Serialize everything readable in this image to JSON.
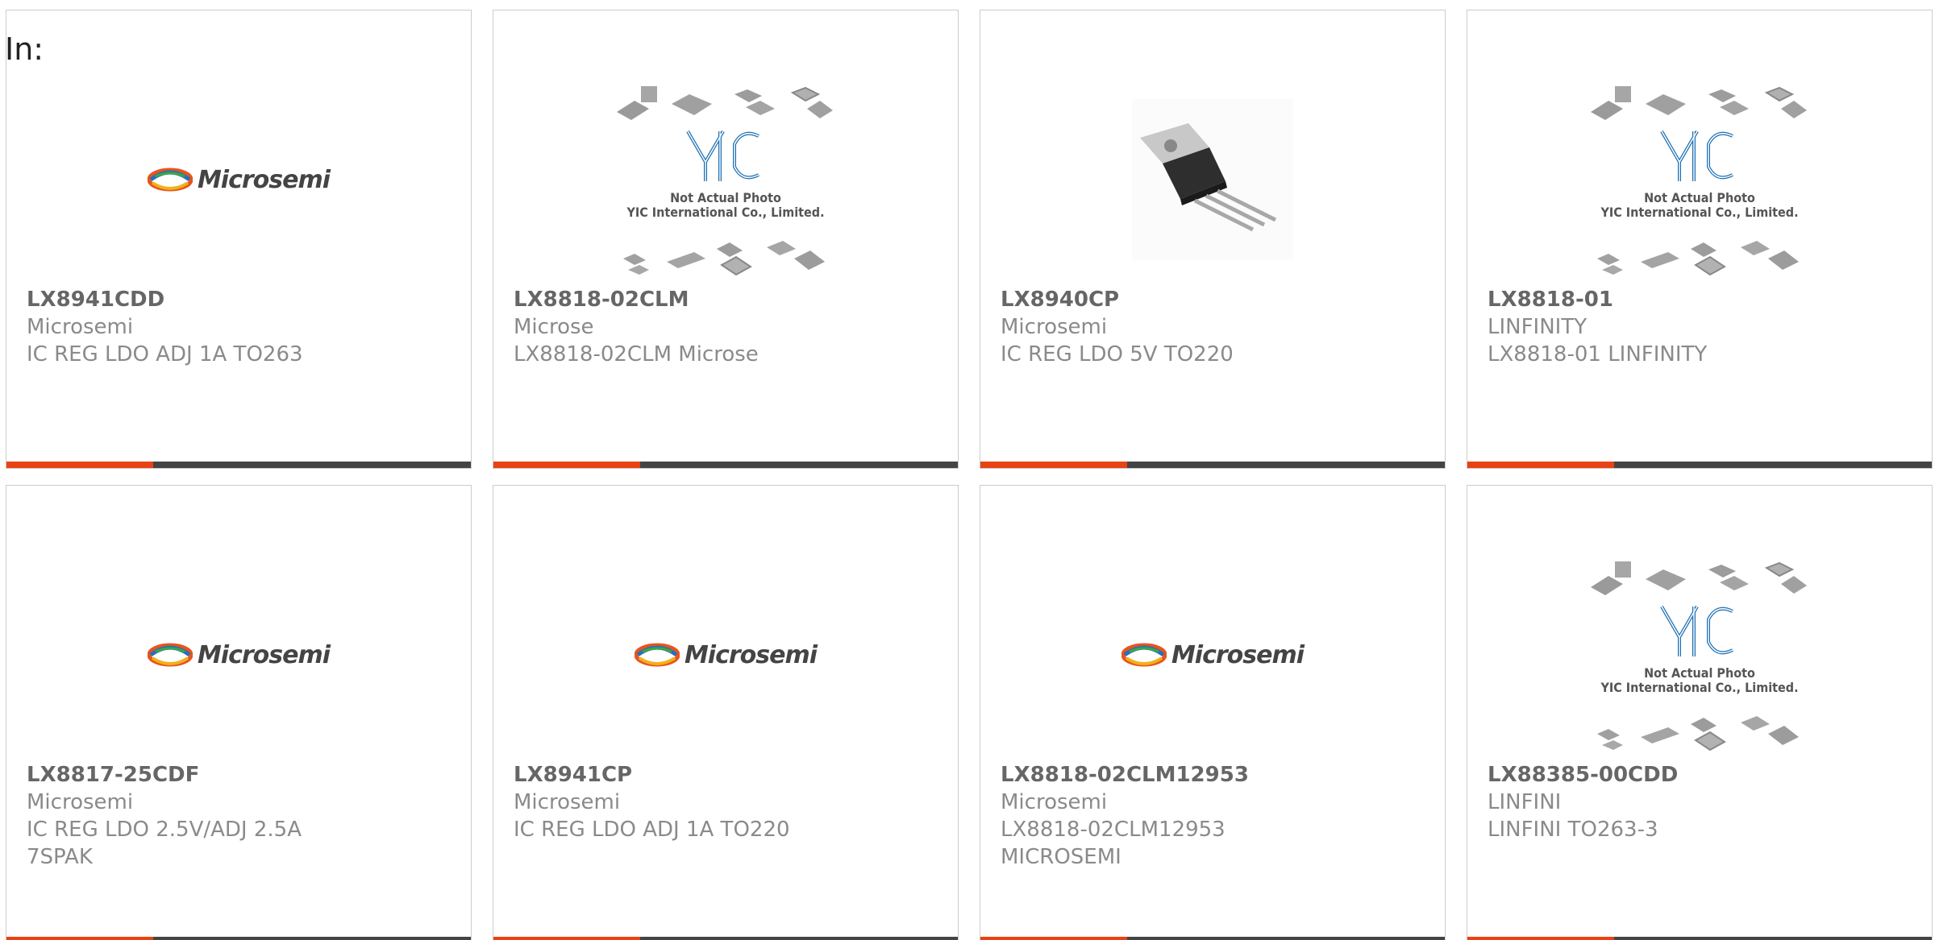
{
  "header": {
    "in_label": "In:"
  },
  "colors": {
    "accent": "#e84315",
    "bar": "#444444",
    "yic_blue": "#1c6fb3"
  },
  "placeholder_text": {
    "line1": "Not Actual Photo",
    "line2": "YIC International Co., Limited."
  },
  "logo_text": "Microsemi",
  "products": [
    {
      "part": "LX8941CDD",
      "manufacturer": "Microsemi",
      "description": "IC REG LDO ADJ 1A TO263",
      "image": "microsemi-logo"
    },
    {
      "part": "LX8818-02CLM",
      "manufacturer": "Microse",
      "description": "LX8818-02CLM Microse",
      "image": "yic-placeholder"
    },
    {
      "part": "LX8940CP",
      "manufacturer": "Microsemi",
      "description": "IC REG LDO 5V TO220",
      "image": "to220-photo"
    },
    {
      "part": "LX8818-01",
      "manufacturer": "LINFINITY",
      "description": "LX8818-01 LINFINITY",
      "image": "yic-placeholder"
    },
    {
      "part": "LX8817-25CDF",
      "manufacturer": "Microsemi",
      "description": "IC REG LDO 2.5V/ADJ 2.5A 7SPAK",
      "image": "microsemi-logo"
    },
    {
      "part": "LX8941CP",
      "manufacturer": "Microsemi",
      "description": "IC REG LDO ADJ 1A TO220",
      "image": "microsemi-logo"
    },
    {
      "part": "LX8818-02CLM12953",
      "manufacturer": "Microsemi",
      "description": "LX8818-02CLM12953 MICROSEMI",
      "image": "microsemi-logo"
    },
    {
      "part": "LX88385-00CDD",
      "manufacturer": "LINFINI",
      "description": "LINFINI TO263-3",
      "image": "yic-placeholder"
    }
  ]
}
